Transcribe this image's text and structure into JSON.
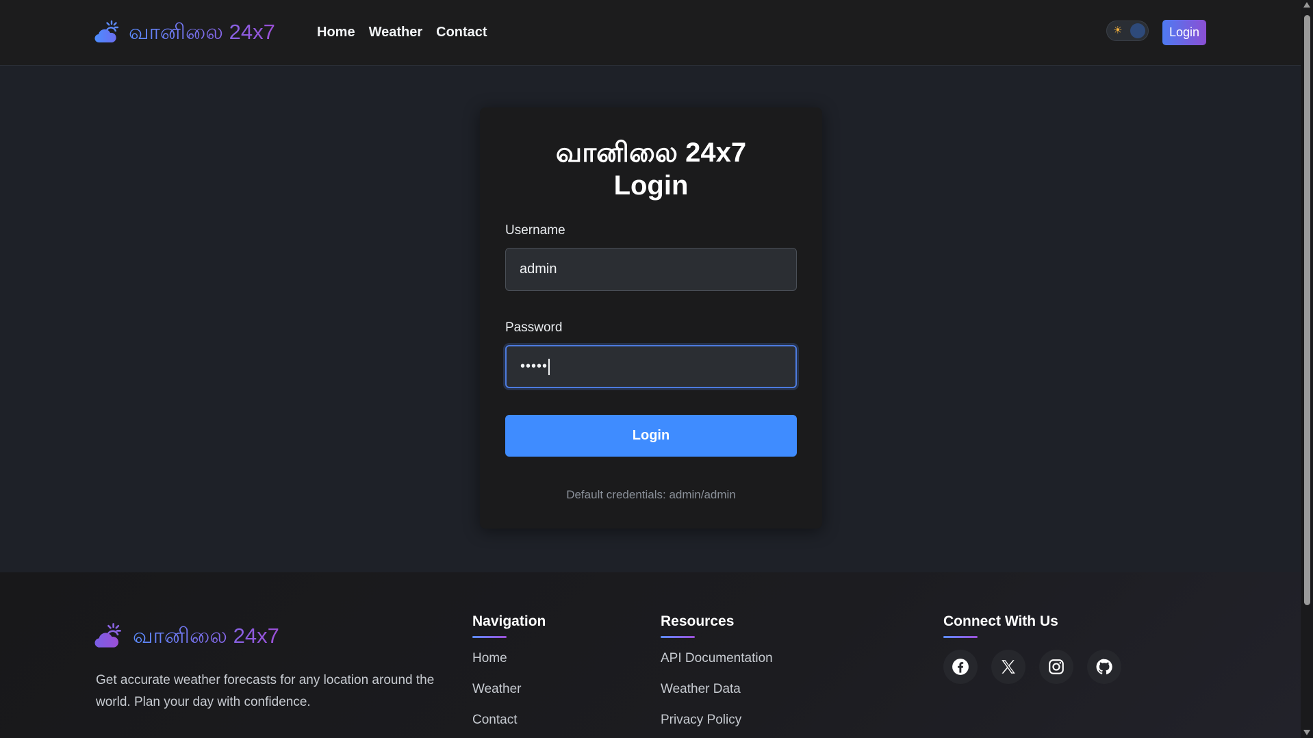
{
  "navbar": {
    "brand": "வானிலை 24x7",
    "links": [
      "Home",
      "Weather",
      "Contact"
    ],
    "login_label": "Login"
  },
  "login_card": {
    "title_line1": "வானிலை 24x7",
    "title_line2": "Login",
    "username_label": "Username",
    "username_value": "admin",
    "password_label": "Password",
    "password_value": "•••••",
    "submit_label": "Login",
    "hint": "Default credentials: admin/admin"
  },
  "footer": {
    "brand": "வானிலை 24x7",
    "description": "Get accurate weather forecasts for any location around the world. Plan your day with confidence.",
    "navigation": {
      "heading": "Navigation",
      "links": [
        "Home",
        "Weather",
        "Contact"
      ]
    },
    "resources": {
      "heading": "Resources",
      "links": [
        "API Documentation",
        "Weather Data",
        "Privacy Policy"
      ]
    },
    "connect": {
      "heading": "Connect With Us",
      "icons": [
        "facebook-icon",
        "x-icon",
        "instagram-icon",
        "github-icon"
      ]
    }
  },
  "colors": {
    "accent_blue": "#3f8cff",
    "gradient_start": "#5b8cff",
    "gradient_end": "#9b4fd6",
    "background": "#1e2128"
  }
}
